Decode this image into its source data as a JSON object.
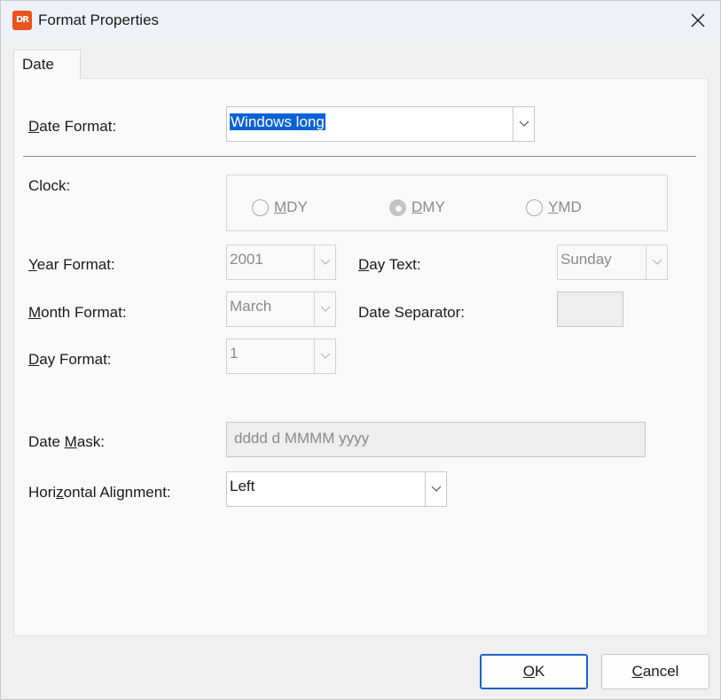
{
  "window": {
    "title": "Format Properties",
    "app_icon_text": "DR"
  },
  "tabs": [
    {
      "label": "Date",
      "active": true
    }
  ],
  "date_format": {
    "label_u": "D",
    "label_rest": "ate Format:",
    "value": "Windows long"
  },
  "clock": {
    "label": "Clock:",
    "options": [
      {
        "u": "M",
        "rest": "DY",
        "checked": false
      },
      {
        "u": "D",
        "rest": "MY",
        "checked": true
      },
      {
        "u": "Y",
        "rest": "MD",
        "checked": false
      }
    ]
  },
  "year_format": {
    "label_u": "Y",
    "label_rest": "ear Format:",
    "value": "2001"
  },
  "month_format": {
    "label_u": "M",
    "label_rest": "onth Format:",
    "value": "March"
  },
  "day_format": {
    "label_u": "D",
    "label_rest": "ay Format:",
    "value": "1"
  },
  "day_text": {
    "label_u": "D",
    "label_rest": "ay Text:",
    "value": "Sunday"
  },
  "date_separator": {
    "label": "Date Separator:",
    "value": ""
  },
  "date_mask": {
    "label_pre": "Date ",
    "label_u": "M",
    "label_rest": "ask:",
    "value": "dddd d MMMM yyyy"
  },
  "horizontal_alignment": {
    "label_pre": "Hori",
    "label_u": "z",
    "label_rest": "ontal Alignment:",
    "value": "Left"
  },
  "buttons": {
    "ok_u": "O",
    "ok_rest": "K",
    "cancel_u": "C",
    "cancel_rest": "ancel"
  },
  "colors": {
    "accent": "#1a63c9",
    "selection": "#0a63d6",
    "app_icon": "#e8541c"
  }
}
